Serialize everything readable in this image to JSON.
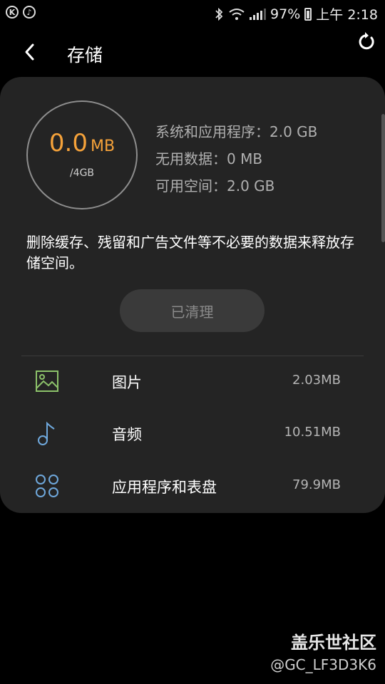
{
  "status": {
    "left_icons": [
      "K",
      "♪"
    ],
    "battery": "97%",
    "time": "上午 2:18"
  },
  "header": {
    "title": "存储"
  },
  "summary": {
    "used_value": "0.0",
    "used_unit": "MB",
    "total": "/4GB",
    "system_apps": "系统和应用程序：2.0 GB",
    "useless_data": "无用数据：0 MB",
    "available": "可用空间：2.0 GB"
  },
  "description": "删除缓存、残留和广告文件等不必要的数据来释放存储空间。",
  "clean_button": "已清理",
  "items": [
    {
      "label": "图片",
      "size": "2.03MB",
      "icon": "image-icon"
    },
    {
      "label": "音频",
      "size": "10.51MB",
      "icon": "music-note-icon"
    },
    {
      "label": "应用程序和表盘",
      "size": "79.9MB",
      "icon": "apps-grid-icon"
    }
  ],
  "watermark": {
    "line1": "盖乐世社区",
    "line2": "@GC_LF3D3K6"
  },
  "colors": {
    "accent": "#f5a23a",
    "card": "#242424",
    "image_icon": "#8cc26a",
    "audio_icon": "#6fa8dc",
    "apps_icon": "#6fa8dc"
  }
}
